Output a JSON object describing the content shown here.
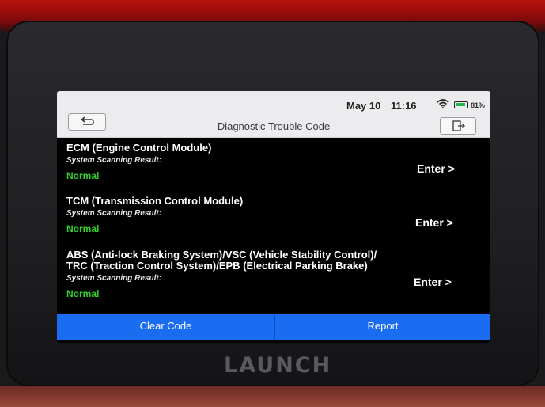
{
  "status_bar": {
    "date": "May 10",
    "time": "11:16",
    "battery": "81%"
  },
  "header": {
    "title": "Diagnostic Trouble Code"
  },
  "modules": [
    {
      "name": "ECM (Engine Control Module)",
      "result_label": "System Scanning Result:",
      "status": "Normal",
      "action": "Enter >"
    },
    {
      "name": "TCM (Transmission Control Module)",
      "result_label": "System Scanning Result:",
      "status": "Normal",
      "action": "Enter >"
    },
    {
      "name_line1": "ABS (Anti-lock Braking System)/VSC (Vehicle Stability Control)/",
      "name_line2": "TRC (Traction Control System)/EPB (Electrical Parking Brake)",
      "result_label": "System Scanning Result:",
      "status": "Normal",
      "action": "Enter >"
    }
  ],
  "footer": {
    "clear_label": "Clear Code",
    "report_label": "Report"
  },
  "device": {
    "brand": "LAUNCH"
  },
  "colors": {
    "status_normal": "#2fd42a",
    "action_blue": "#1a6cf0"
  }
}
